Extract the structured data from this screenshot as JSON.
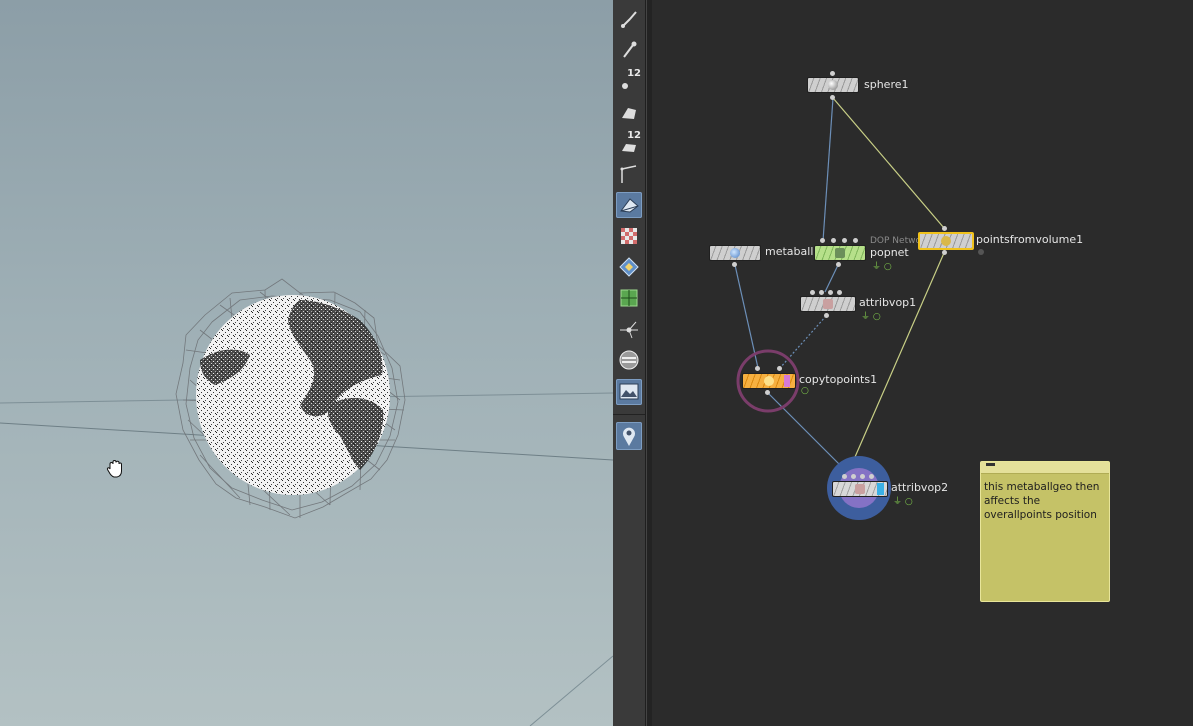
{
  "viewport": {
    "cursor_icon": "hand-pan-icon"
  },
  "toolbar": {
    "tools": [
      {
        "icon": "brush-icon"
      },
      {
        "icon": "pin-icon"
      },
      {
        "icon": "point-count-icon",
        "number": "12"
      },
      {
        "icon": "face-select-icon"
      },
      {
        "icon": "face-count-icon",
        "number": "12"
      },
      {
        "icon": "edge-curve-icon"
      },
      {
        "icon": "shaded-wireframe-icon",
        "active": true
      },
      {
        "icon": "checker-texture-icon"
      },
      {
        "icon": "uv-icon"
      },
      {
        "icon": "grid-display-icon"
      },
      {
        "icon": "vertex-icon"
      },
      {
        "icon": "background-icon"
      },
      {
        "icon": "image-plane-icon",
        "active": true
      },
      {
        "icon": "location-pin-icon",
        "active": true
      }
    ]
  },
  "network": {
    "nodes": {
      "sphere1": {
        "label": "sphere1",
        "icon": "sphere-icon"
      },
      "metaball1": {
        "label": "metaball1",
        "icon": "metaball-icon"
      },
      "popnet": {
        "label": "popnet",
        "sublabel": "DOP Network",
        "icon": "dop-network-icon"
      },
      "pointsfromvolume1": {
        "label": "pointsfromvolume1",
        "icon": "points-from-volume-icon"
      },
      "attribvop1": {
        "label": "attribvop1",
        "icon": "vop-icon"
      },
      "copytopoints1": {
        "label": "copytopoints1",
        "icon": "copy-to-points-icon"
      },
      "attribvop2": {
        "label": "attribvop2",
        "icon": "vop-icon"
      }
    },
    "sticky_note": {
      "text": "this metaballgeo then affects the overallpoints position",
      "color": "#c5c267"
    },
    "colors": {
      "wire_blue": "#6c8fb8",
      "wire_yellow": "#c8cf86",
      "display_flag": "#7ec54b",
      "copy_ring": "#7a3d6a",
      "attribvop2_ring": "#3d5e9e",
      "copy_node": "#f4a22c",
      "popnet_node": "#9ed56f",
      "pfv_border": "#f0c21c"
    }
  }
}
